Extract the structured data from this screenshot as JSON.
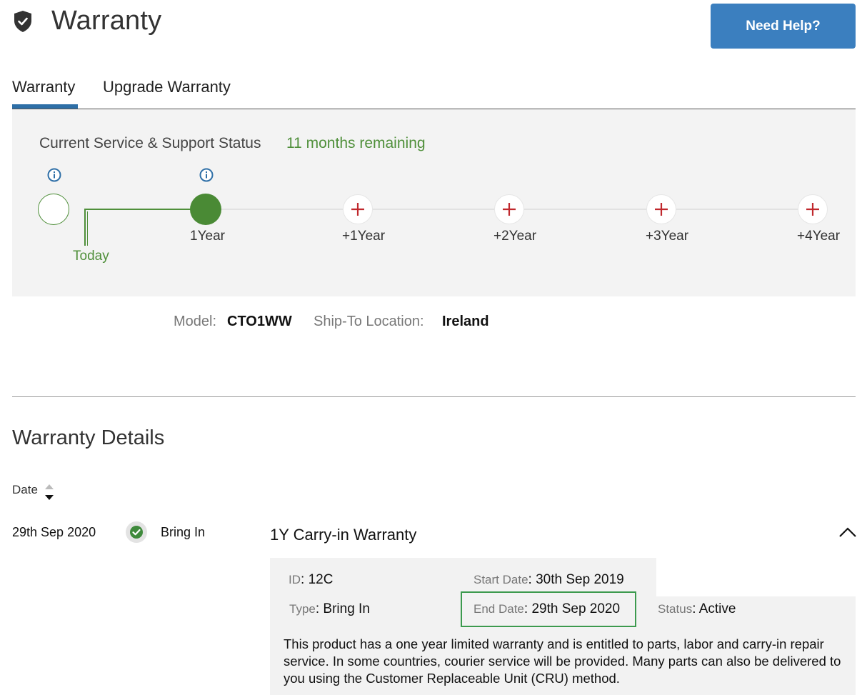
{
  "header": {
    "title": "Warranty",
    "help_button": "Need Help?"
  },
  "tabs": [
    {
      "label": "Warranty",
      "active": true
    },
    {
      "label": "Upgrade Warranty",
      "active": false
    }
  ],
  "status": {
    "label": "Current Service & Support Status",
    "remaining": "11 months remaining",
    "today_label": "Today",
    "timeline": [
      "1Year",
      "+1Year",
      "+2Year",
      "+3Year",
      "+4Year"
    ]
  },
  "product": {
    "model_label": "Model:",
    "model_value": "CTO1WW",
    "location_label": "Ship-To Location:",
    "location_value": "Ireland"
  },
  "details": {
    "title": "Warranty Details",
    "sort_label": "Date",
    "row": {
      "date": "29th Sep 2020",
      "type": "Bring In",
      "title": "1Y Carry-in Warranty",
      "id_label": "ID",
      "id_value": "12C",
      "start_label": "Start Date",
      "start_value": "30th Sep 2019",
      "type_label": "Type",
      "type_value": "Bring In",
      "end_label": "End Date",
      "end_value": "29th Sep 2020",
      "status_label": "Status",
      "status_value": "Active",
      "description": "This product has a one year limited warranty and is entitled to parts, labor and carry-in repair service. In some countries, courier service will be provided. Many parts can also be delivered to you using the Customer Replaceable Unit (CRU) method."
    }
  },
  "colors": {
    "accent": "#3b7fbf",
    "green": "#4f8f3a",
    "plus_red": "#c0282d",
    "highlight_border": "#3c9a4e"
  }
}
